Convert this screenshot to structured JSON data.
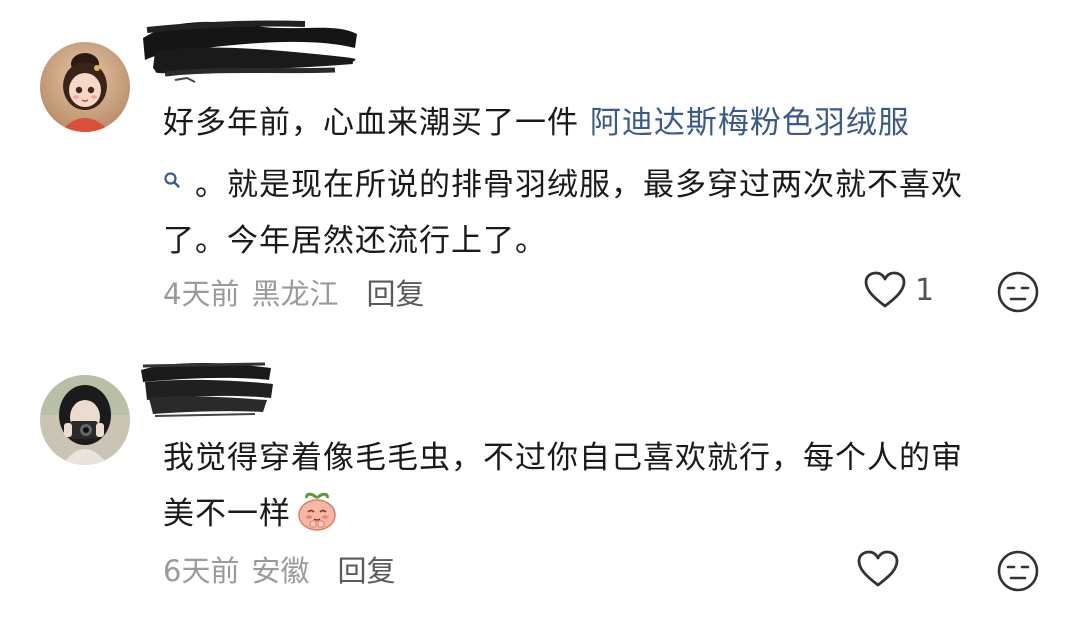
{
  "comments": [
    {
      "avatar_icon": "cartoon-girl-avatar",
      "username": "",
      "body_prefix": "好多年前，心血来潮买了一件",
      "body_link": "阿迪达斯梅粉色羽绒服",
      "body_line2": "。就是现在所说的排骨羽绒服，最多穿过两次就不喜欢",
      "body_line3": "了。今年居然还流行上了。",
      "time": "4天前",
      "location": "黑龙江",
      "reply_label": "回复",
      "like_count": "1",
      "link_color": "#3b5a8c"
    },
    {
      "avatar_icon": "girl-with-camera-avatar",
      "username": "",
      "body_line1": "我觉得穿着像毛毛虫，不过你自己喜欢就行，每个人的审",
      "body_line2": "美不一样",
      "emoji_icon": "shy-peach-emoji",
      "time": "6天前",
      "location": "安徽",
      "reply_label": "回复",
      "like_count": ""
    }
  ]
}
